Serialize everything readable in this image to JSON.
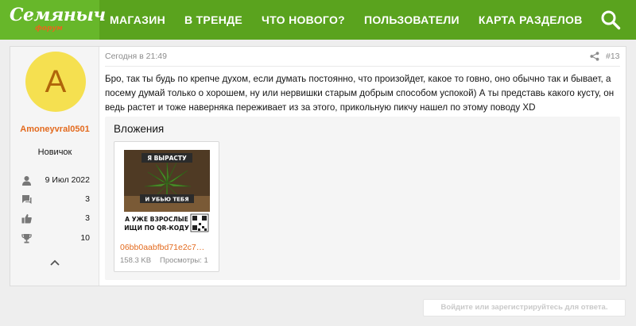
{
  "header": {
    "logo": {
      "main": "Семяныч",
      "sub": "форум"
    },
    "nav": [
      "МАГАЗИН",
      "В ТРЕНДЕ",
      "ЧТО НОВОГО?",
      "ПОЛЬЗОВАТЕЛИ",
      "КАРТА РАЗДЕЛОВ"
    ],
    "search_icon": "search-icon"
  },
  "post": {
    "user": {
      "avatar_letter": "A",
      "username": "Amoneyvral0501",
      "title": "Новичок",
      "stats": [
        {
          "icon": "user-icon",
          "value": "9 Июл 2022"
        },
        {
          "icon": "messages-icon",
          "value": "3"
        },
        {
          "icon": "thumbs-up-icon",
          "value": "3"
        },
        {
          "icon": "trophy-icon",
          "value": "10"
        }
      ]
    },
    "time": "Сегодня в 21:49",
    "number": "#13",
    "message": "Бро, так ты будь по крепче духом, если думать постоянно, что произойдет, какое то говно, оно обычно так и бывает, а посему думай только о хорошем, ну или нервишки старым добрым способом успокой) А ты представь какого кусту, он ведь растет и тоже наверняка переживает из за этого, прикольную пикчу нашел по этому поводу XD",
    "attachments_title": "Вложения",
    "attachment": {
      "meme_top": "Я ВЫРАСТУ",
      "meme_mid": "И УБЬЮ ТЕБЯ",
      "meme_bottom_1": "А УЖЕ ВЗРОСЛЫЕ",
      "meme_bottom_2": "ИЩИ ПО QR-КОДУ",
      "name": "06bb0aabfbd71e2c7…",
      "size": "158.3 KB",
      "views": "Просмотры: 1"
    }
  },
  "reply_prompt": "Войдите или зарегистрируйтесь для ответа.",
  "colors": {
    "header": "#5aa31e",
    "accent": "#e36a1e",
    "avatar_bg": "#f5e050"
  }
}
